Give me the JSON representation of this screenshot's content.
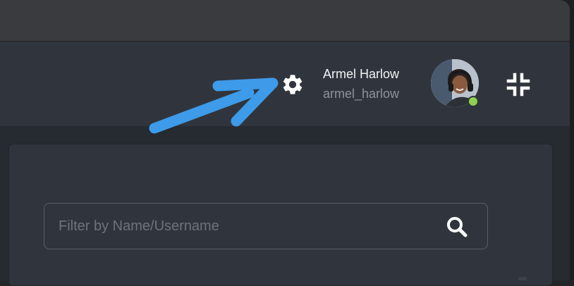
{
  "header": {
    "settings_icon": "gear-icon",
    "user": {
      "name": "Armel Harlow",
      "username": "armel_harlow",
      "status": "online",
      "status_color": "#8fd14f"
    },
    "collapse_icon": "collapse-icon"
  },
  "search": {
    "placeholder": "Filter by Name/Username",
    "value": "",
    "icon": "search-icon"
  },
  "annotation": {
    "arrow_color": "#3d9be9"
  }
}
